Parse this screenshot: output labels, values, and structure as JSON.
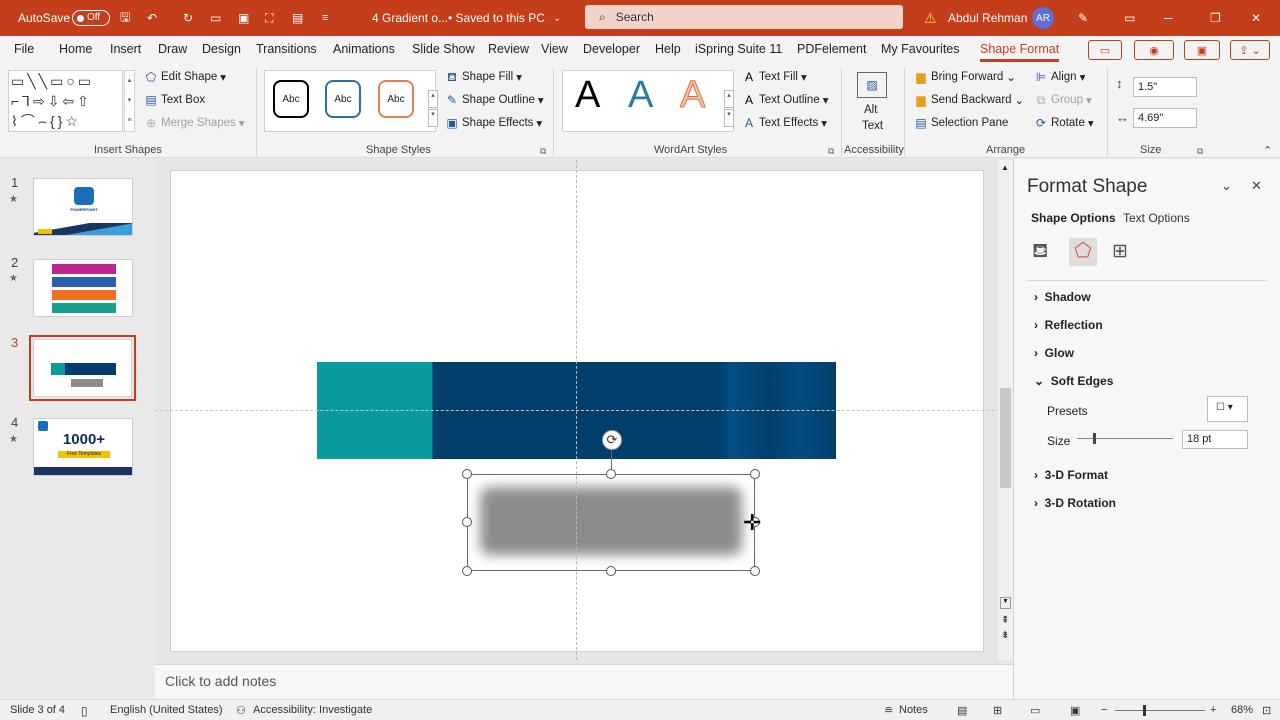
{
  "titlebar": {
    "autosave_label": "AutoSave",
    "autosave_state": "Off",
    "doc_name": "4 Gradient o...",
    "save_status": "• Saved to this PC",
    "search_placeholder": "Search",
    "user_name": "Abdul Rehman",
    "user_initials": "AR",
    "accent_color": "#c43e1c"
  },
  "menu": {
    "tabs": [
      "File",
      "Home",
      "Insert",
      "Draw",
      "Design",
      "Transitions",
      "Animations",
      "Slide Show",
      "Review",
      "View",
      "Developer",
      "Help",
      "iSpring Suite 11",
      "PDFelement",
      "My Favourites",
      "Shape Format"
    ],
    "active_tab": "Shape Format"
  },
  "ribbon": {
    "insert_shapes": {
      "edit_shape": "Edit Shape",
      "text_box": "Text Box",
      "merge_shapes": "Merge Shapes",
      "label": "Insert Shapes"
    },
    "shape_styles": {
      "sample": "Abc",
      "fill": "Shape Fill",
      "outline": "Shape Outline",
      "effects": "Shape Effects",
      "label": "Shape Styles"
    },
    "wordart": {
      "letter": "A",
      "fill": "Text Fill",
      "outline": "Text Outline",
      "effects": "Text Effects",
      "label": "WordArt Styles"
    },
    "accessibility": {
      "alt": "Alt",
      "text": "Text",
      "label": "Accessibility"
    },
    "arrange": {
      "bring_forward": "Bring Forward",
      "send_backward": "Send Backward",
      "selection_pane": "Selection Pane",
      "align": "Align",
      "group": "Group",
      "rotate": "Rotate",
      "label": "Arrange"
    },
    "size": {
      "height": "1.5\"",
      "width": "4.69\"",
      "label": "Size"
    }
  },
  "slides": [
    {
      "number": "1",
      "star": "★",
      "tag": "POWERPOINT"
    },
    {
      "number": "2",
      "star": "★"
    },
    {
      "number": "3",
      "star": ""
    },
    {
      "number": "4",
      "star": "★",
      "tag": "1000+",
      "sub": "Free Templates"
    }
  ],
  "active_slide": 3,
  "notes_placeholder": "Click to add notes",
  "format_pane": {
    "title": "Format Shape",
    "tabs": [
      "Shape Options",
      "Text Options"
    ],
    "sections": [
      "Shadow",
      "Reflection",
      "Glow",
      "Soft Edges",
      "3-D Format",
      "3-D Rotation"
    ],
    "presets_label": "Presets",
    "size_label": "Size",
    "size_value": "18 pt"
  },
  "status": {
    "slide_info": "Slide 3 of 4",
    "language": "English (United States)",
    "accessibility": "Accessibility: Investigate",
    "notes": "Notes",
    "zoom": "68%"
  },
  "colors": {
    "teal": "#0b9a9e",
    "navy": "#023e6b",
    "gray": "#8c8c8c"
  }
}
